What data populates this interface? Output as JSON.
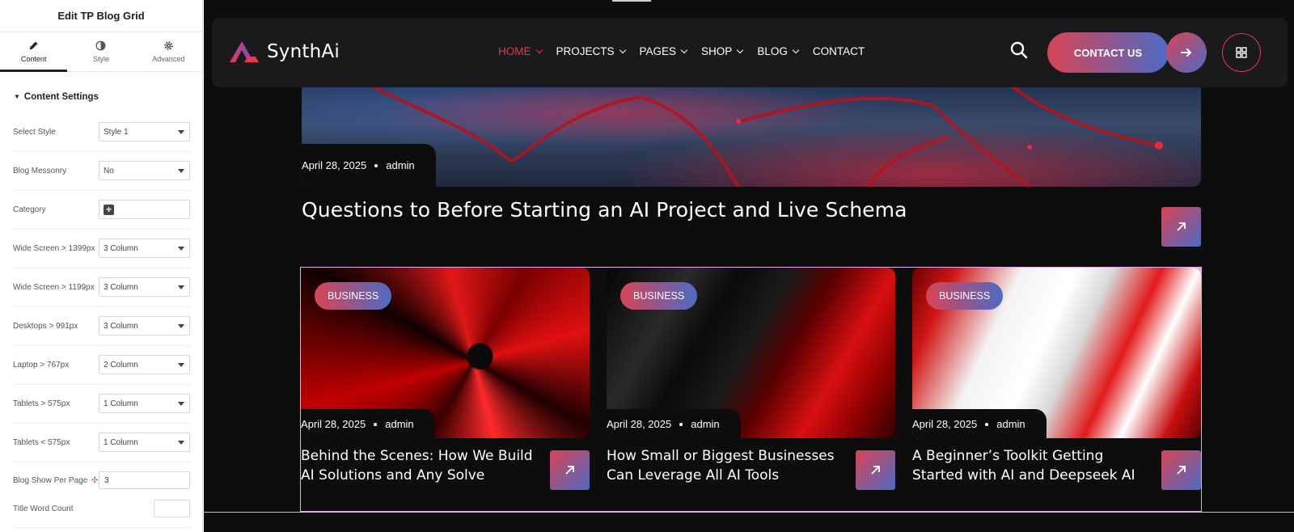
{
  "panel": {
    "title": "Edit TP Blog Grid",
    "tabs": [
      {
        "label": "Content",
        "icon": "pencil-icon"
      },
      {
        "label": "Style",
        "icon": "contrast-icon"
      },
      {
        "label": "Advanced",
        "icon": "gear-icon"
      }
    ],
    "section_title": "Content Settings",
    "controls": [
      {
        "label": "Select Style",
        "value": "Style 1"
      },
      {
        "label": "Blog Messonry",
        "value": "No"
      },
      {
        "label": "Category",
        "value": ""
      },
      {
        "label": "Wide Screen > 1399px",
        "value": "3 Column"
      },
      {
        "label": "Wide Screen > 1199px",
        "value": "3 Column"
      },
      {
        "label": "Desktops > 991px",
        "value": "3 Column"
      },
      {
        "label": "Laptop > 767px",
        "value": "2 Column"
      },
      {
        "label": "Tablets > 575px",
        "value": "1 Column"
      },
      {
        "label": "Tablets < 575px",
        "value": "1 Column"
      },
      {
        "label": "Blog Show Per Page",
        "value": "3"
      },
      {
        "label": "Title Word Count",
        "value": ""
      }
    ]
  },
  "site": {
    "logo": "SynthAi",
    "nav": [
      "HOME",
      "PROJECTS",
      "PAGES",
      "SHOP",
      "BLOG",
      "CONTACT"
    ],
    "active_nav": "HOME",
    "contact_button": "CONTACT US",
    "accent": "#e5394b",
    "gradient_start": "#d84454",
    "gradient_end": "#4c6bc6"
  },
  "featured": {
    "date": "April 28, 2025",
    "author": "admin",
    "title": "Questions to Before Starting an AI Project and Live Schema"
  },
  "posts": [
    {
      "category": "BUSINESS",
      "date": "April 28, 2025",
      "author": "admin",
      "title": "Behind the Scenes: How We Build AI Solutions and Any Solve"
    },
    {
      "category": "BUSINESS",
      "date": "April 28, 2025",
      "author": "admin",
      "title": "How Small or Biggest Businesses Can Leverage All AI Tools"
    },
    {
      "category": "BUSINESS",
      "date": "April 28, 2025",
      "author": "admin",
      "title": "A Beginner’s Toolkit Getting Started with AI and Deepseek AI"
    }
  ]
}
